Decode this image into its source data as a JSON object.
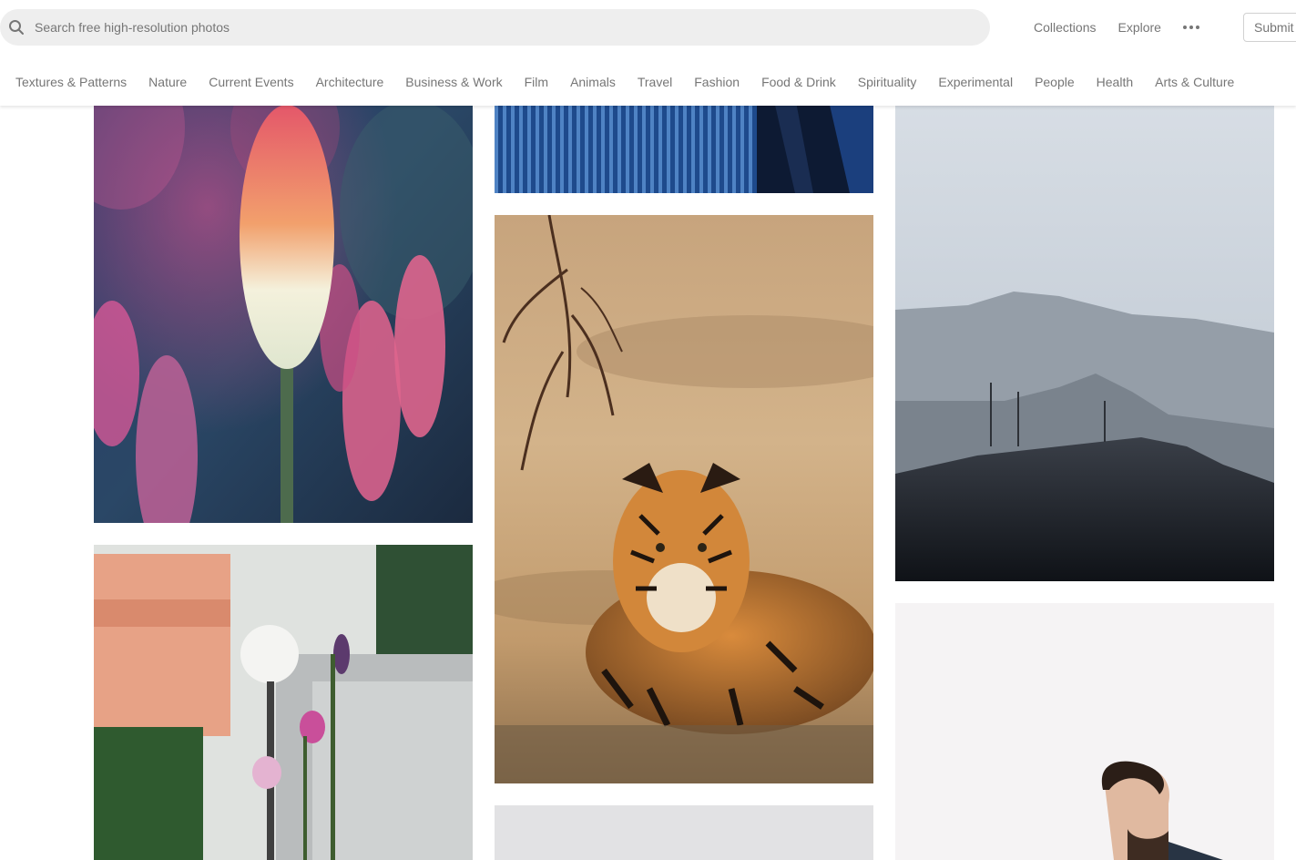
{
  "search": {
    "placeholder": "Search free high-resolution photos",
    "value": ""
  },
  "top_nav": {
    "links": [
      "Collections",
      "Explore"
    ],
    "more_icon": "ellipsis-icon",
    "submit_label": "Submit"
  },
  "categories": [
    "Textures & Patterns",
    "Nature",
    "Current Events",
    "Architecture",
    "Business & Work",
    "Film",
    "Animals",
    "Travel",
    "Fashion",
    "Food & Drink",
    "Spirituality",
    "Experimental",
    "People",
    "Health",
    "Arts & Culture"
  ],
  "photos": [
    {
      "subject": "red hot poker flowers"
    },
    {
      "subject": "blue corrugated wall"
    },
    {
      "subject": "misty mountains"
    },
    {
      "subject": "tiger lying on dirt"
    },
    {
      "subject": "flower bouquet near building"
    },
    {
      "subject": "grey placeholder"
    },
    {
      "subject": "man portrait against white sky"
    }
  ],
  "colors": {
    "text_muted": "#767676",
    "search_bg": "#eeeeee",
    "placeholder_gray": "#e2e2e4"
  }
}
